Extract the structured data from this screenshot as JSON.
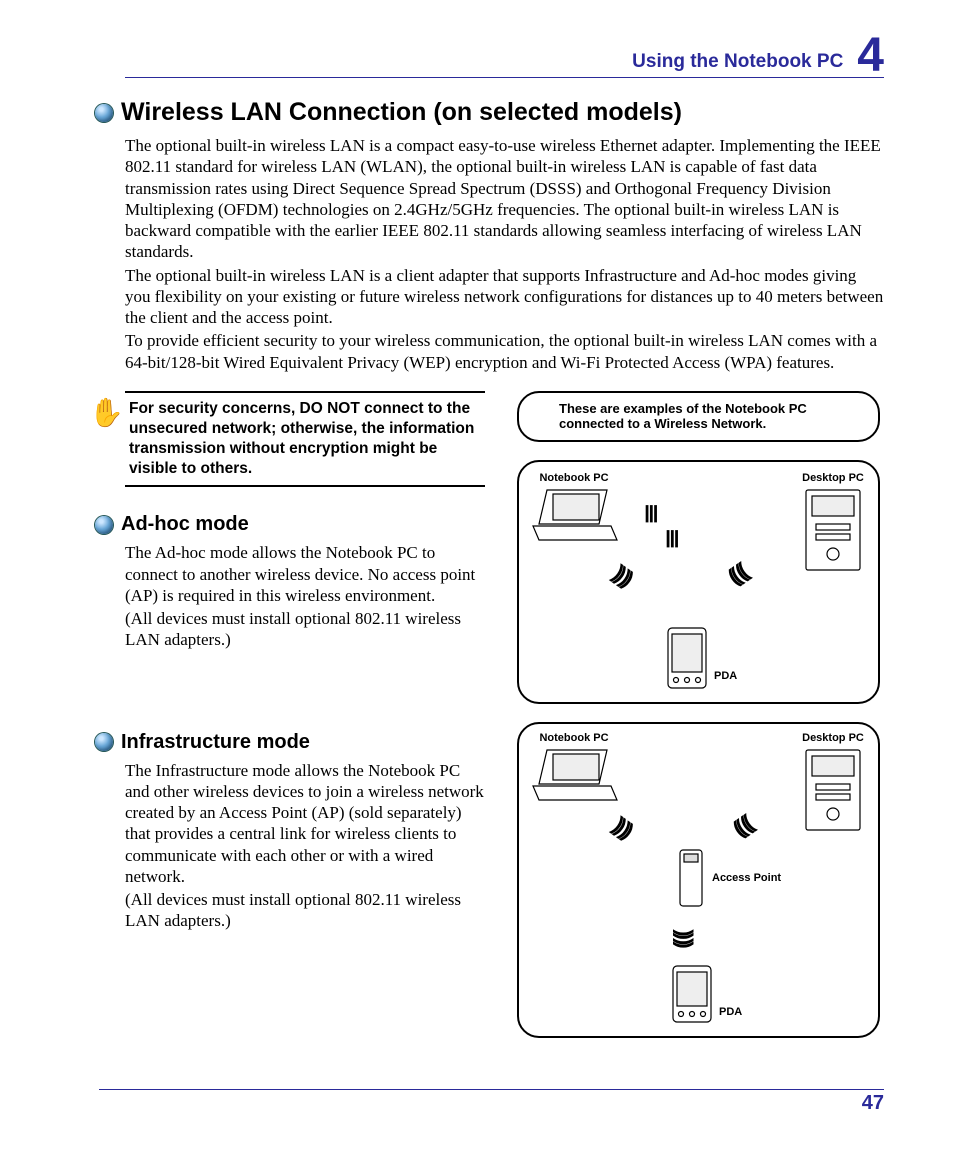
{
  "header": {
    "title": "Using the Notebook PC",
    "chapter": "4"
  },
  "main": {
    "title": "Wireless LAN Connection (on selected models)",
    "p1": "The optional built-in wireless LAN is a compact easy-to-use wireless Ethernet adapter. Implementing the IEEE 802.11 standard for wireless LAN (WLAN), the optional built-in wireless LAN is capable of fast data transmission rates using Direct Sequence Spread Spectrum (DSSS) and Orthogonal Frequency Division Multiplexing (OFDM) technologies on 2.4GHz/5GHz frequencies. The optional built-in wireless LAN is backward compatible with the earlier IEEE 802.11 standards allowing seamless interfacing of wireless LAN standards.",
    "p2": "The optional built-in wireless LAN is a client adapter that supports Infrastructure and Ad-hoc modes giving you flexibility on your existing or future wireless network configurations for distances up to 40 meters between the client and the access point.",
    "p3": "To provide efficient security to your wireless communication, the optional built-in wireless LAN comes with a 64-bit/128-bit Wired Equivalent Privacy (WEP) encryption and Wi-Fi Protected Access (WPA) features."
  },
  "note": "For security concerns, DO NOT connect to the unsecured network; otherwise, the information transmission without encryption might be visible to others.",
  "adhoc": {
    "title": "Ad-hoc mode",
    "body": "The Ad-hoc mode allows the Notebook PC to connect to another wireless device. No access point (AP) is required in this wireless environment.",
    "note": "(All devices must install optional 802.11 wireless LAN adapters.)"
  },
  "infra": {
    "title": "Infrastructure mode",
    "body": "The Infrastructure mode allows the Notebook PC and other wireless devices to join a wireless network created by an Access Point (AP) (sold separately) that provides a central link for wireless clients to communicate with each other or with a wired network.",
    "note": "(All devices must install optional 802.11 wireless LAN adapters.)"
  },
  "diagram": {
    "caption": "These are examples of the Notebook PC connected to a Wireless Network.",
    "notebook": "Notebook PC",
    "desktop": "Desktop PC",
    "pda": "PDA",
    "ap": "Access Point"
  },
  "page": "47"
}
